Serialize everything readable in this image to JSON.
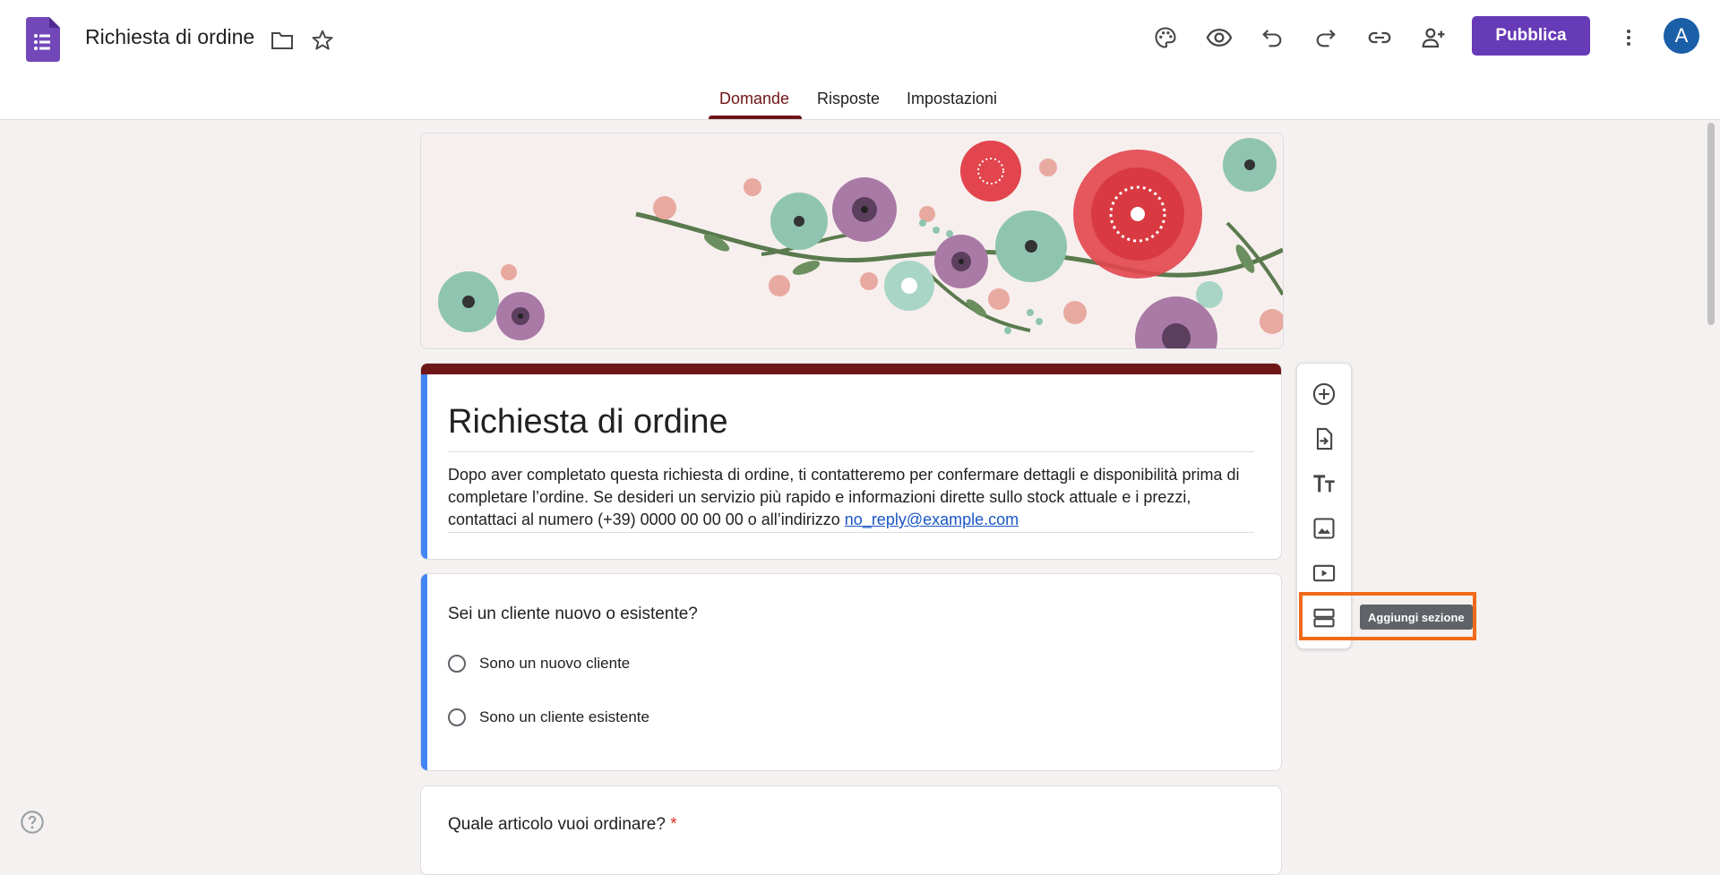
{
  "app": {
    "doc_title": "Richiesta di ordine",
    "publish_label": "Pubblica",
    "avatar_letter": "A"
  },
  "header_icons": [
    "palette-icon",
    "eye-icon",
    "undo-icon",
    "redo-icon",
    "link-icon",
    "add-person-icon",
    "more-vert-icon"
  ],
  "tabs": [
    {
      "label": "Domande",
      "active": true
    },
    {
      "label": "Risposte",
      "active": false
    },
    {
      "label": "Impostazioni",
      "active": false
    }
  ],
  "form": {
    "title": "Richiesta di ordine",
    "description": "Dopo aver completato questa richiesta di ordine, ti contatteremo per confermare dettagli e disponibilità prima di completare l’ordine. Se desideri un servizio più rapido e informazioni dirette sullo stock attuale e i prezzi, contattaci al numero (+39) 0000 00 00 00 o all’indirizzo",
    "email": "no_reply@example.com"
  },
  "questions": [
    {
      "title": "Sei un cliente nuovo o esistente?",
      "required": false,
      "options": [
        "Sono un nuovo cliente",
        "Sono un cliente esistente"
      ]
    },
    {
      "title": "Quale articolo vuoi ordinare?",
      "required": true,
      "required_mark": "*"
    }
  ],
  "side_toolbar": {
    "items": [
      "add-question-icon",
      "import-questions-icon",
      "add-title-icon",
      "add-image-icon",
      "add-video-icon",
      "add-section-icon"
    ],
    "tooltip": "Aggiungi sezione"
  },
  "colors": {
    "theme": "#6e1515",
    "accent_bar": "#4285f4",
    "publish": "#673ab7",
    "highlight": "#f26a1b",
    "background": "#f5f1f0"
  }
}
